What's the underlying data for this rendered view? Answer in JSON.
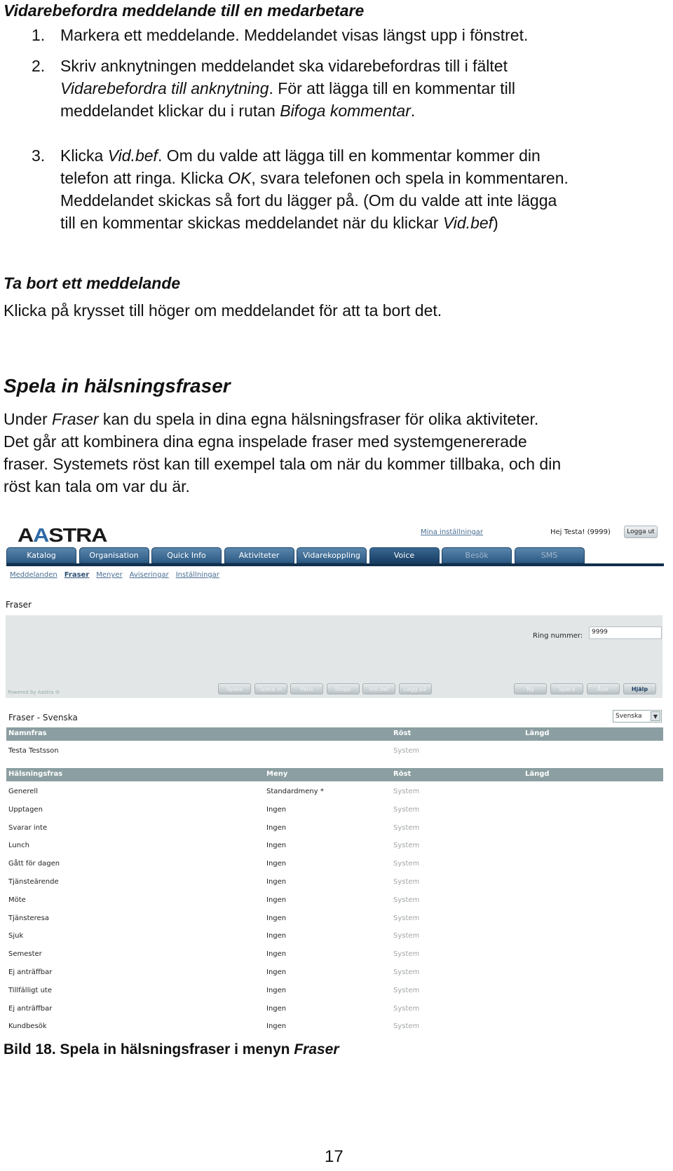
{
  "document": {
    "section1": {
      "heading": "Vidarebefordra meddelande till en medarbetare",
      "steps": [
        {
          "num": "1.",
          "parts": [
            {
              "t": "Markera ett meddelande. Meddelandet visas längst upp i fönstret."
            }
          ]
        },
        {
          "num": "2.",
          "lines": [
            "Skriv anknytningen meddelandet ska vidarebefordras till i fältet",
            "<em>Vidarebefordra till anknytning</em>. För att lägga till en kommentar till",
            "meddelandet klickar du i rutan <em>Bifoga kommentar</em>."
          ]
        },
        {
          "num": "3.",
          "lines": [
            "Klicka <em>Vid.bef</em>. Om du valde att lägga till en kommentar kommer din",
            "telefon att ringa. Klicka <em>OK</em>, svara telefonen och spela in kommentaren.",
            "Meddelandet skickas så fort du lägger på. (Om du valde att inte lägga",
            "till en kommentar skickas meddelandet när du klickar <em>Vid.bef</em>)"
          ]
        }
      ],
      "step1_text": "Markera ett meddelande. Meddelandet visas längst upp i fönstret."
    },
    "section2": {
      "heading": "Ta bort ett meddelande",
      "body": "Klicka på krysset till höger om meddelandet för att ta bort det."
    },
    "section3": {
      "heading": "Spela in hälsningsfraser",
      "lines": [
        "Under <em>Fraser</em> kan du spela in dina egna hälsningsfraser för olika aktiviteter.",
        "Det går att kombinera dina egna inspelade fraser med systemgenererade",
        "fraser. Systemets röst kan till exempel tala om när du kommer tillbaka, och din",
        "röst kan tala om var du är."
      ]
    },
    "caption_prefix": "Bild 18. Spela in hälsningsfraser i menyn ",
    "caption_italic": "Fraser",
    "page_number": "17"
  },
  "app": {
    "logo_text": "AASTRA",
    "my_settings_link": "Mina inställningar",
    "greeting": "Hej Testa! (9999)",
    "logout_label": "Logga ut",
    "tabs": [
      {
        "label": "Katalog",
        "state": "normal"
      },
      {
        "label": "Organisation",
        "state": "normal"
      },
      {
        "label": "Quick Info",
        "state": "normal"
      },
      {
        "label": "Aktiviteter",
        "state": "normal"
      },
      {
        "label": "Vidarekoppling",
        "state": "normal"
      },
      {
        "label": "Voice",
        "state": "active"
      },
      {
        "label": "Besök",
        "state": "disabled"
      },
      {
        "label": "SMS",
        "state": "disabled"
      }
    ],
    "subnav": [
      {
        "label": "Meddelanden",
        "current": false
      },
      {
        "label": "Fraser",
        "current": true
      },
      {
        "label": "Menyer",
        "current": false
      },
      {
        "label": "Aviseringar",
        "current": false
      },
      {
        "label": "Inställningar",
        "current": false
      }
    ],
    "section_title": "Fraser",
    "ring_label": "Ring nummer:",
    "ring_value": "9999",
    "powered_by": "Powered by Aastra ®",
    "player_buttons": [
      {
        "label": "Spela",
        "enabled": false
      },
      {
        "label": "Spela in",
        "enabled": false
      },
      {
        "label": "Paus",
        "enabled": false
      },
      {
        "label": "Stopp",
        "enabled": false
      },
      {
        "label": "Vid.bef",
        "enabled": false
      },
      {
        "label": "Lägg på",
        "enabled": false
      }
    ],
    "action_buttons": [
      {
        "label": "Ny",
        "enabled": false
      },
      {
        "label": "Spara",
        "enabled": false
      },
      {
        "label": "Åter",
        "enabled": false
      },
      {
        "label": "Hjälp",
        "enabled": true
      }
    ],
    "list_title": "Fraser - Svenska",
    "language_select": "Svenska",
    "name_table": {
      "headers": [
        "Namnfras",
        "Röst",
        "Längd"
      ],
      "rows": [
        [
          "Testa Testsson",
          "System",
          ""
        ]
      ]
    },
    "greeting_table": {
      "headers": [
        "Hälsningsfras",
        "Meny",
        "Röst",
        "Längd"
      ],
      "rows": [
        [
          "Generell",
          "Standardmeny *",
          "System",
          ""
        ],
        [
          "Upptagen",
          "Ingen",
          "System",
          ""
        ],
        [
          "Svarar inte",
          "Ingen",
          "System",
          ""
        ],
        [
          "Lunch",
          "Ingen",
          "System",
          ""
        ],
        [
          "Gått för dagen",
          "Ingen",
          "System",
          ""
        ],
        [
          "Tjänsteärende",
          "Ingen",
          "System",
          ""
        ],
        [
          "Möte",
          "Ingen",
          "System",
          ""
        ],
        [
          "Tjänsteresa",
          "Ingen",
          "System",
          ""
        ],
        [
          "Sjuk",
          "Ingen",
          "System",
          ""
        ],
        [
          "Semester",
          "Ingen",
          "System",
          ""
        ],
        [
          "Ej anträffbar",
          "Ingen",
          "System",
          ""
        ],
        [
          "Tillfälligt ute",
          "Ingen",
          "System",
          ""
        ],
        [
          "Ej anträffbar",
          "Ingen",
          "System",
          ""
        ],
        [
          "Kundbesök",
          "Ingen",
          "System",
          ""
        ]
      ]
    }
  }
}
